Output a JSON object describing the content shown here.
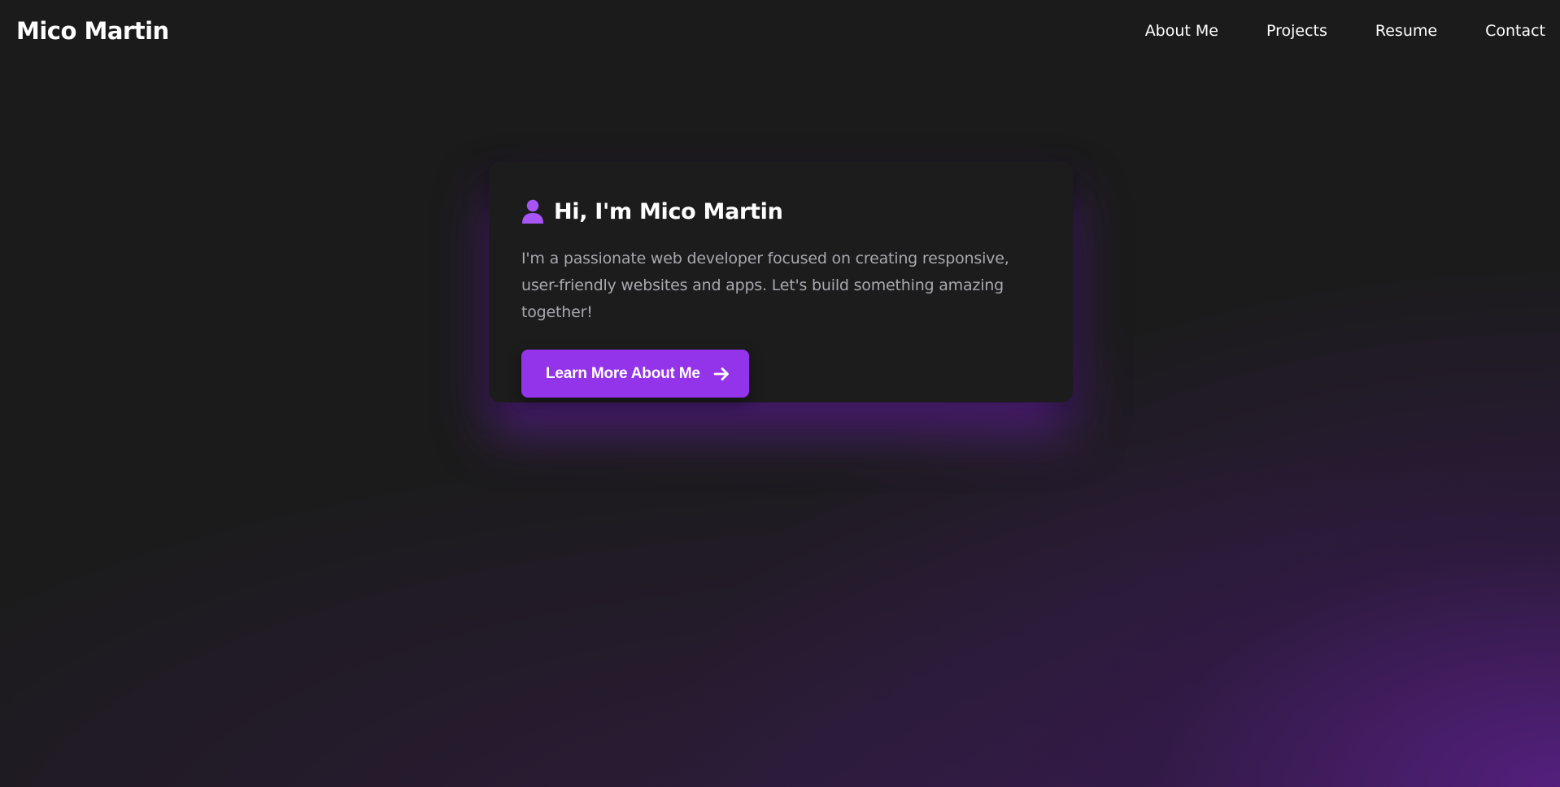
{
  "header": {
    "logo_text": "Mico Martin",
    "nav": [
      {
        "label": "About Me",
        "icon": null
      },
      {
        "label": "Projects",
        "icon": null
      },
      {
        "label": "Resume",
        "icon": null
      },
      {
        "label": "Contact",
        "icon": null
      }
    ]
  },
  "hero": {
    "icon": "user-icon",
    "title": "Hi, I'm Mico Martin",
    "description": "I'm a passionate web developer focused on creating responsive, user-friendly websites and apps. Let's build something amazing together!",
    "cta": {
      "label": "Learn More About Me",
      "icon": "arrow-right-icon"
    }
  },
  "colors": {
    "background": "#1b1b1b",
    "accent": "#9333ea",
    "icon_accent": "#a855f7",
    "card_background": "#1c1c1d",
    "body_text": "#a8a8ae"
  }
}
